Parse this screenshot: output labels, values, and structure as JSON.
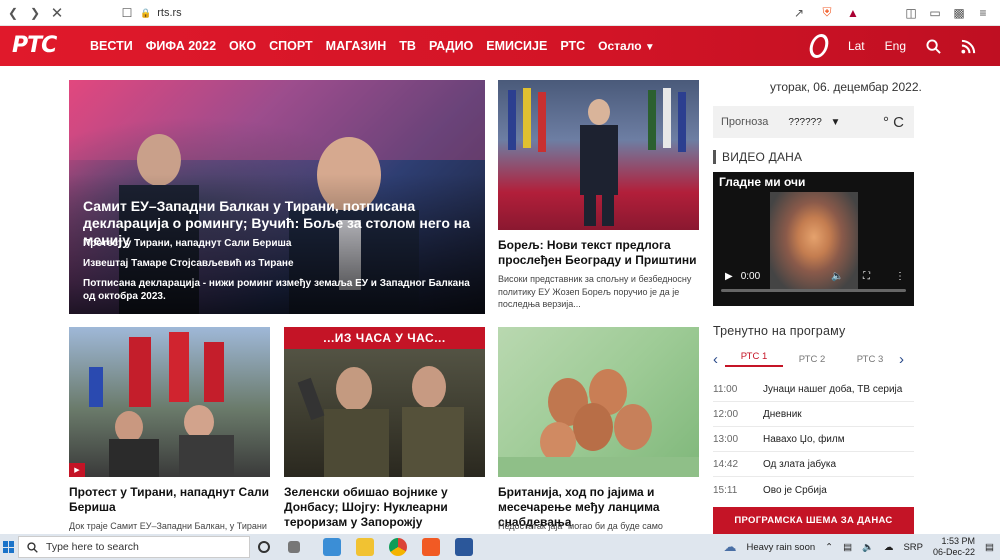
{
  "browser": {
    "url": "rts.rs"
  },
  "nav": {
    "logo": "РТС",
    "items": [
      "ВЕСТИ",
      "ФИФА 2022",
      "ОКО",
      "СПОРТ",
      "МАГАЗИН",
      "ТВ",
      "РАДИО",
      "ЕМИСИЈЕ",
      "РТС"
    ],
    "more": "Остало",
    "lat": "Lat",
    "eng": "Eng"
  },
  "hero": {
    "title": "Самит ЕУ–Западни Балкан у Тирани, потписана декларација о ромингу; Вучић: Боље за столом него на менију",
    "subs": [
      "Протест у Тирани, нападнут Сали Бериша",
      "Извештај Тамаре Стојсављевић из Тиране",
      "Потписана декларација - нижи роминг између земаља ЕУ и Западног Балкана од октобра 2023."
    ]
  },
  "borrell": {
    "title": "Борељ: Нови текст предлога прослеђен Београду и Приштини",
    "desc": "Високи представник за спољну и безбедносну политику ЕУ Жозеп Борељ поручио је да је последња верзија..."
  },
  "cards": [
    {
      "title": "Протест у Тирани, нападнут Сали Бериша",
      "desc": "Док траје Самит ЕУ–Западни Балкан, у Тирани"
    },
    {
      "banner": "...ИЗ ЧАСА У ЧАС...",
      "title": "Зеленски обишао војнике у Донбасу; Шојгу: Нуклеарни тероризам у Запорожју",
      "desc": ""
    },
    {
      "title": "Британија, ход по јајима и месечарење међу ланцима снабдевања",
      "desc": "Недостатак јаја \"могао би да буде само"
    }
  ],
  "sidebar": {
    "date": "уторак, 06. децембар 2022.",
    "weather_label": "Прогноза",
    "weather_city": "??????",
    "weather_unit": "° C",
    "video_head": "ВИДЕО ДАНА",
    "video_title": "Гладне ми очи",
    "video_time": "0:00",
    "program_head": "Тренутно на програму",
    "tabs": [
      "РТС 1",
      "РТС 2",
      "РТС 3"
    ],
    "schedule": [
      {
        "time": "11:00",
        "show": "Јунаци нашег доба, ТВ серија"
      },
      {
        "time": "12:00",
        "show": "Дневник"
      },
      {
        "time": "13:00",
        "show": "Навахо Џо, филм"
      },
      {
        "time": "14:42",
        "show": "Од злата јабука"
      },
      {
        "time": "15:11",
        "show": "Ово је Србија"
      }
    ],
    "program_button": "ПРОГРАМСКА ШЕМА ЗА ДАНАС"
  },
  "taskbar": {
    "search_placeholder": "Type here to search",
    "weather": "Heavy rain soon",
    "lang": "SRP",
    "time": "1:53 PM",
    "date": "06-Dec-22"
  }
}
